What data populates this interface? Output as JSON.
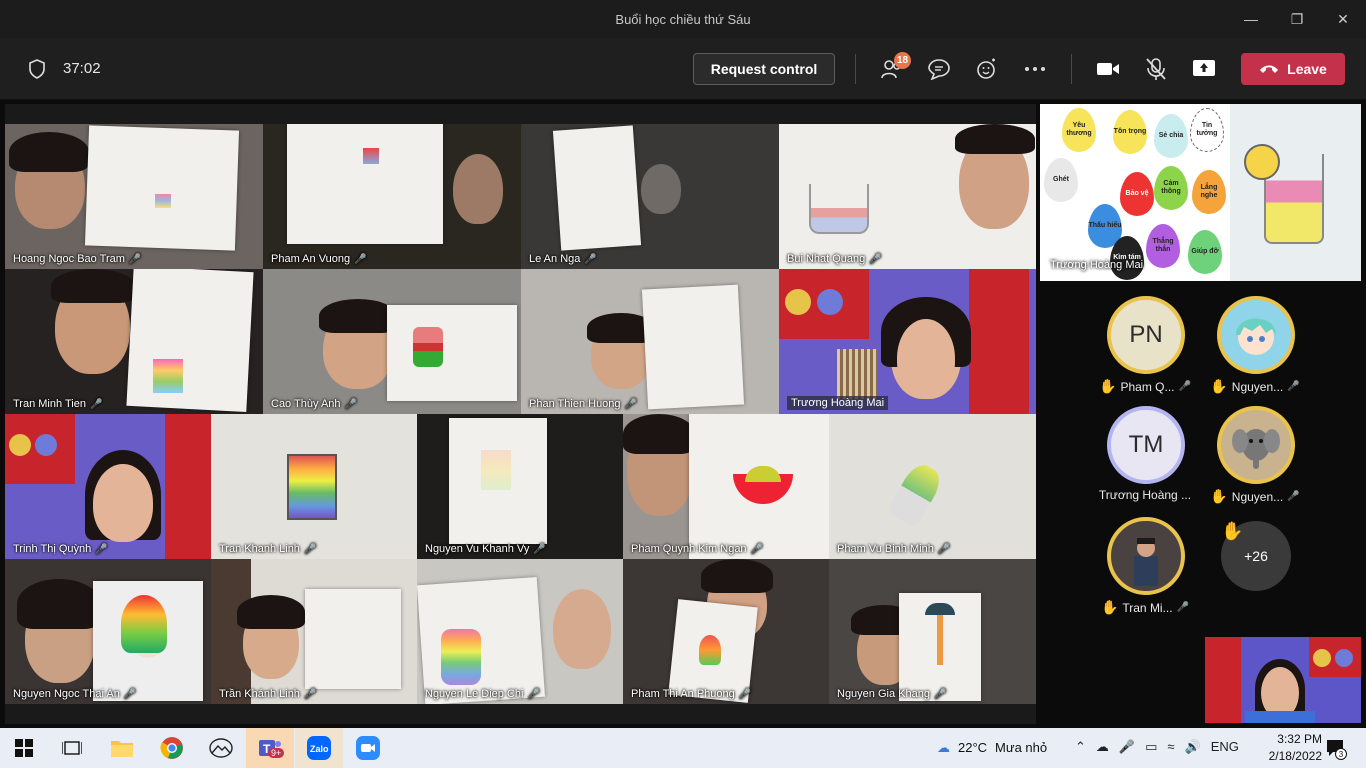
{
  "window": {
    "title": "Buổi học chiều thứ Sáu"
  },
  "toolbar": {
    "timer": "37:02",
    "request_control": "Request control",
    "participants_badge": "18",
    "leave": "Leave"
  },
  "colors": {
    "leave": "#c4314b",
    "badge": "#e97548",
    "hand": "#e9b43a",
    "ring": "#e9c34b"
  },
  "tiles": [
    {
      "name": "Hoang Ngoc Bao Tram"
    },
    {
      "name": "Pham An Vuong"
    },
    {
      "name": "Le An Nga"
    },
    {
      "name": "Bui Nhat Quang"
    },
    {
      "name": "Tran Minh Tien"
    },
    {
      "name": "Cao Thùy Anh"
    },
    {
      "name": "Phan Thien Huong"
    },
    {
      "name": "Trương Hoàng Mai"
    },
    {
      "name": "Trinh Thị Quỳnh"
    },
    {
      "name": "Tran Khanh Linh"
    },
    {
      "name": "Nguyen Vu Khanh Vy"
    },
    {
      "name": "Pham Quynh Kim Ngan"
    },
    {
      "name": "Pham Vu Binh Minh"
    },
    {
      "name": "Nguyen Ngoc Thai An"
    },
    {
      "name": "Trần Khánh Linh"
    },
    {
      "name": "Nguyen Le Diep Chi"
    },
    {
      "name": "Pham Thi An Phuong"
    },
    {
      "name": "Nguyen Gia Khang"
    }
  ],
  "share": {
    "presenter": "Trương Hoàng Mai",
    "drops": [
      "Yêu thương",
      "Tôn trọng",
      "Sẻ chia",
      "Tin tưởng",
      "Ghét",
      "Bảo vệ",
      "Cảm thông",
      "Lắng nghe",
      "Thấu hiểu",
      "Thẳng thắn",
      "Giúp đỡ",
      "Kìm tám"
    ]
  },
  "roster": [
    {
      "initials": "PN",
      "name": "Pham Q...",
      "hand": true
    },
    {
      "initials": "",
      "name": "Nguyen...",
      "hand": true
    },
    {
      "initials": "TM",
      "name": "Trương Hoàng ...",
      "hand": false
    },
    {
      "initials": "",
      "name": "Nguyen...",
      "hand": true
    },
    {
      "initials": "",
      "name": "Tran Mi...",
      "hand": true
    }
  ],
  "overflow": "+26",
  "taskbar": {
    "temperature": "22°C",
    "weather": "Mưa nhỏ",
    "lang": "ENG",
    "time": "3:32 PM",
    "date": "2/18/2022",
    "notifications": "3",
    "teams_badge": "9+"
  }
}
